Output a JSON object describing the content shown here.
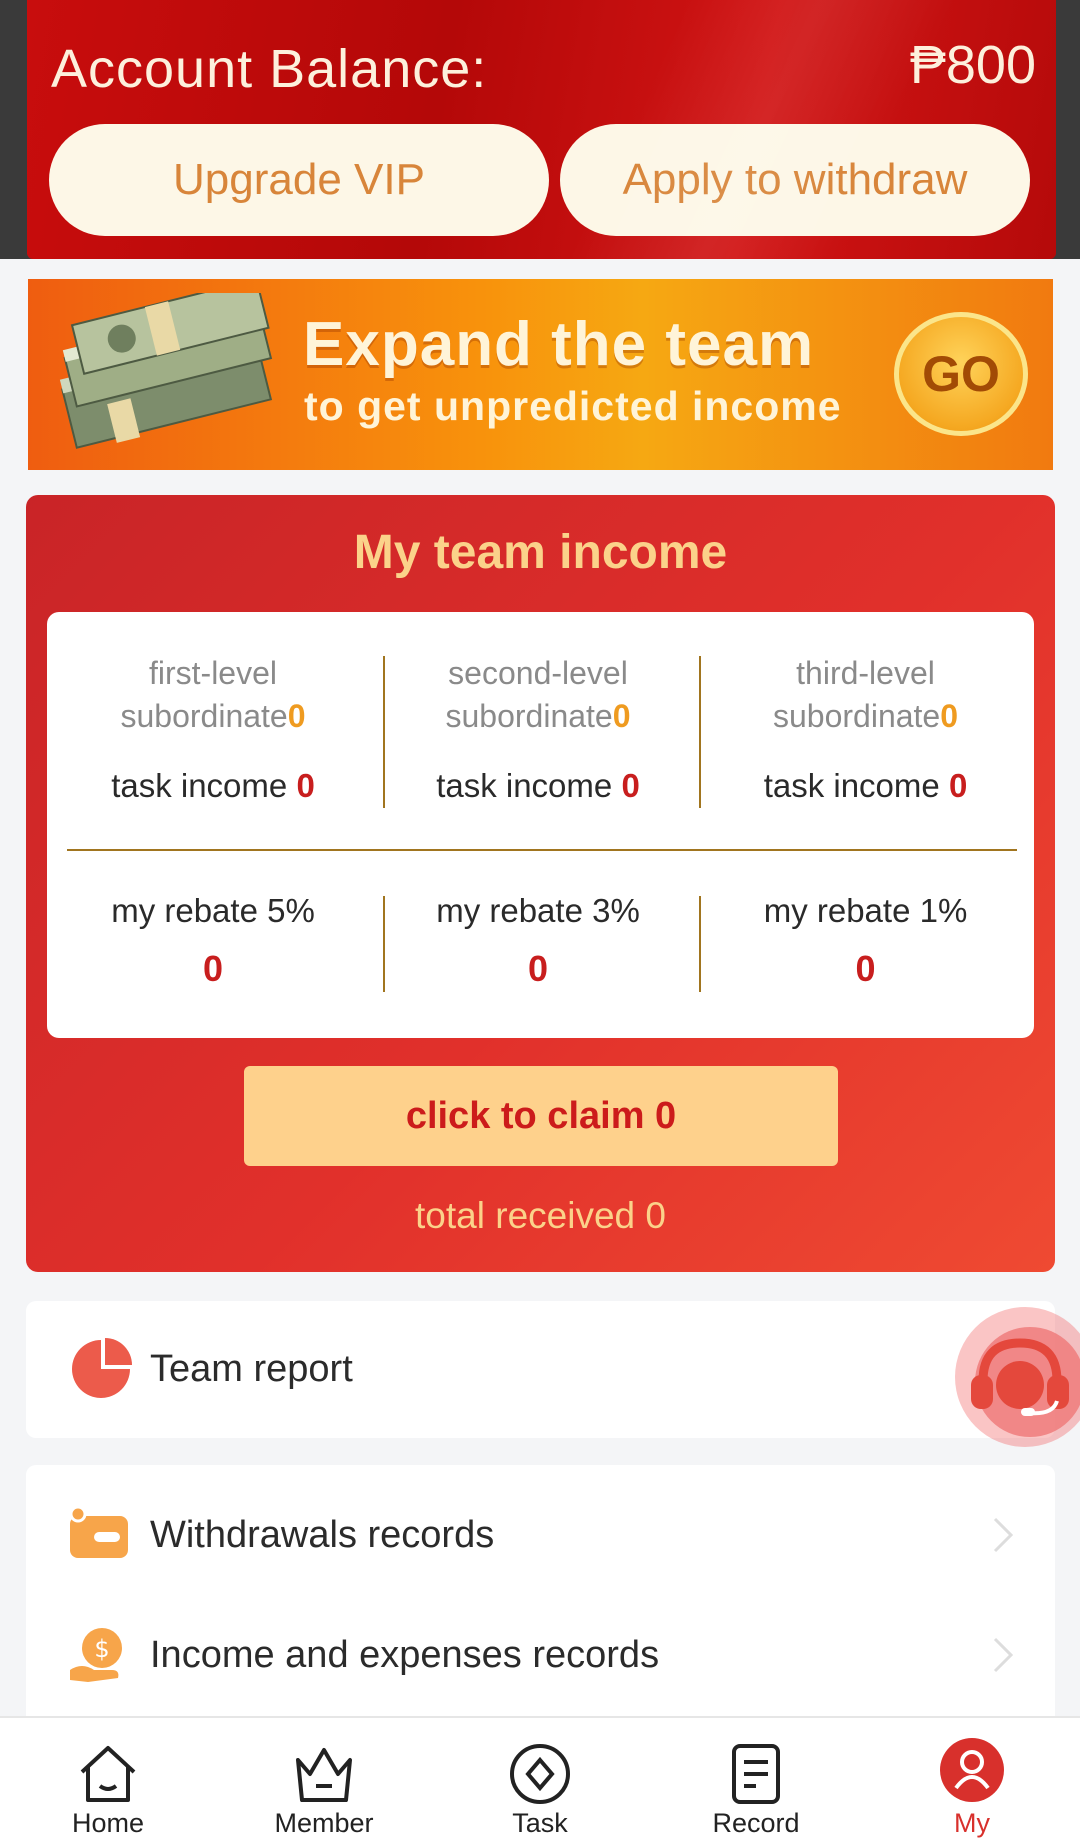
{
  "balance": {
    "label": "Account Balance:",
    "value": "₱800"
  },
  "actions": {
    "upgrade_vip": "Upgrade VIP",
    "withdraw": "Apply to withdraw"
  },
  "promo": {
    "title": "Expand the team",
    "subtitle": "to get unpredicted income",
    "go": "GO"
  },
  "team_income": {
    "title": "My team income",
    "levels": [
      {
        "level": "first-level",
        "subordinate_label": "subordinate",
        "subordinate_value": "0",
        "task_label": "task income",
        "task_value": "0"
      },
      {
        "level": "second-level",
        "subordinate_label": "subordinate",
        "subordinate_value": "0",
        "task_label": "task income",
        "task_value": "0"
      },
      {
        "level": "third-level",
        "subordinate_label": "subordinate",
        "subordinate_value": "0",
        "task_label": "task income",
        "task_value": "0"
      }
    ],
    "rebates": [
      {
        "label": "my rebate 5%",
        "value": "0"
      },
      {
        "label": "my rebate 3%",
        "value": "0"
      },
      {
        "label": "my rebate 1%",
        "value": "0"
      }
    ],
    "claim": "click to claim 0",
    "total_received": "total received 0"
  },
  "menu": {
    "team_report": "Team report",
    "withdrawals": "Withdrawals records",
    "income_expenses": "Income and expenses records"
  },
  "nav": [
    {
      "label": "Home",
      "icon": "home-icon"
    },
    {
      "label": "Member",
      "icon": "crown-icon"
    },
    {
      "label": "Task",
      "icon": "task-icon"
    },
    {
      "label": "Record",
      "icon": "record-icon"
    },
    {
      "label": "My",
      "icon": "user-icon"
    }
  ],
  "colors": {
    "primary_red": "#d8302c",
    "gold_text": "#fbd28a",
    "claim_bg": "#fed18c",
    "orange_accent": "#ef9b20"
  }
}
